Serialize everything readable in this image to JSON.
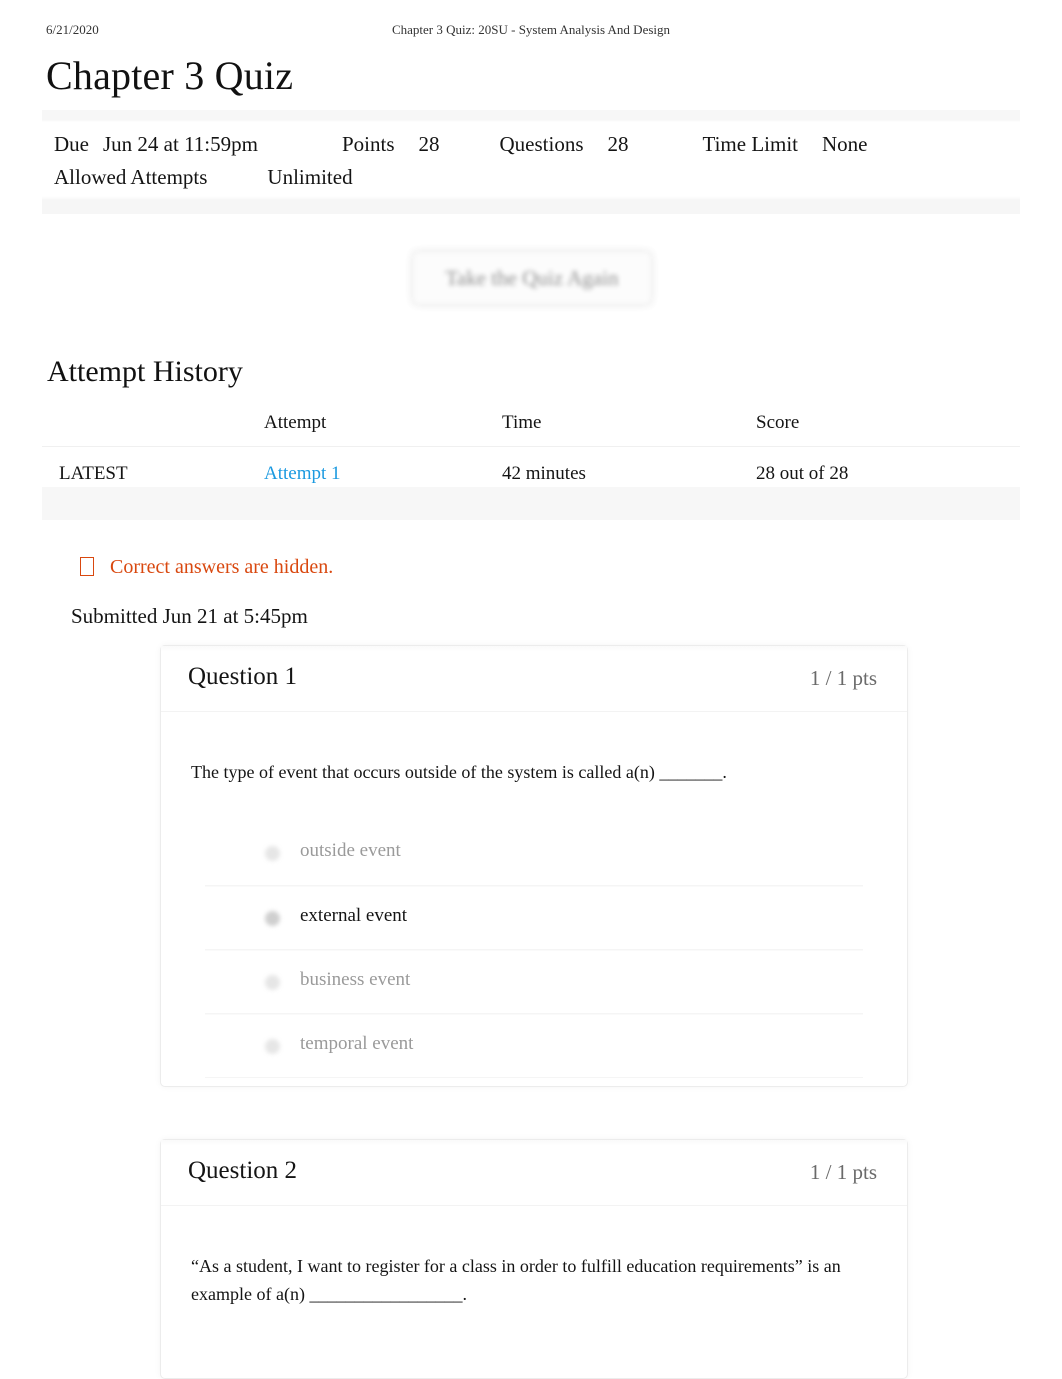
{
  "print_header": {
    "date": "6/21/2020",
    "title": "Chapter 3 Quiz: 20SU - System Analysis And Design"
  },
  "page_title": "Chapter 3 Quiz",
  "quiz_details": {
    "due_label": "Due",
    "due_value": "Jun 24 at 11:59pm",
    "points_label": "Points",
    "points_value": "28",
    "questions_label": "Questions",
    "questions_value": "28",
    "time_limit_label": "Time Limit",
    "time_limit_value": "None",
    "allowed_attempts_label": "Allowed Attempts",
    "allowed_attempts_value": "Unlimited"
  },
  "retake_button": {
    "label": "Take the Quiz Again"
  },
  "attempt_history": {
    "heading": "Attempt History",
    "columns": [
      "",
      "Attempt",
      "Time",
      "Score"
    ],
    "rows": [
      {
        "marker": "LATEST",
        "attempt": "Attempt 1",
        "time": "42 minutes",
        "score": "28 out of 28"
      }
    ]
  },
  "warning": {
    "icon": "warning-icon",
    "text": "Correct answers are hidden.",
    "color": "#d9480f"
  },
  "submitted": "Submitted Jun 21 at 5:45pm",
  "questions": [
    {
      "name": "Question 1",
      "points": "1 / 1 pts",
      "text": "The type of event that occurs outside of the system is called a(n) _______.",
      "answers": [
        {
          "label": "outside event",
          "selected": false
        },
        {
          "label": "external event",
          "selected": true
        },
        {
          "label": "business event",
          "selected": false
        },
        {
          "label": "temporal event",
          "selected": false
        }
      ]
    },
    {
      "name": "Question 2",
      "points": "1 / 1 pts",
      "text": "“As a student, I want to register for a class in order to fulfill education requirements” is an example of a(n) _________________.",
      "answers": []
    }
  ],
  "colors": {
    "link": "#1c9ae0",
    "warning": "#d9480f",
    "text": "#141414",
    "muted": "#6a6a6a"
  }
}
